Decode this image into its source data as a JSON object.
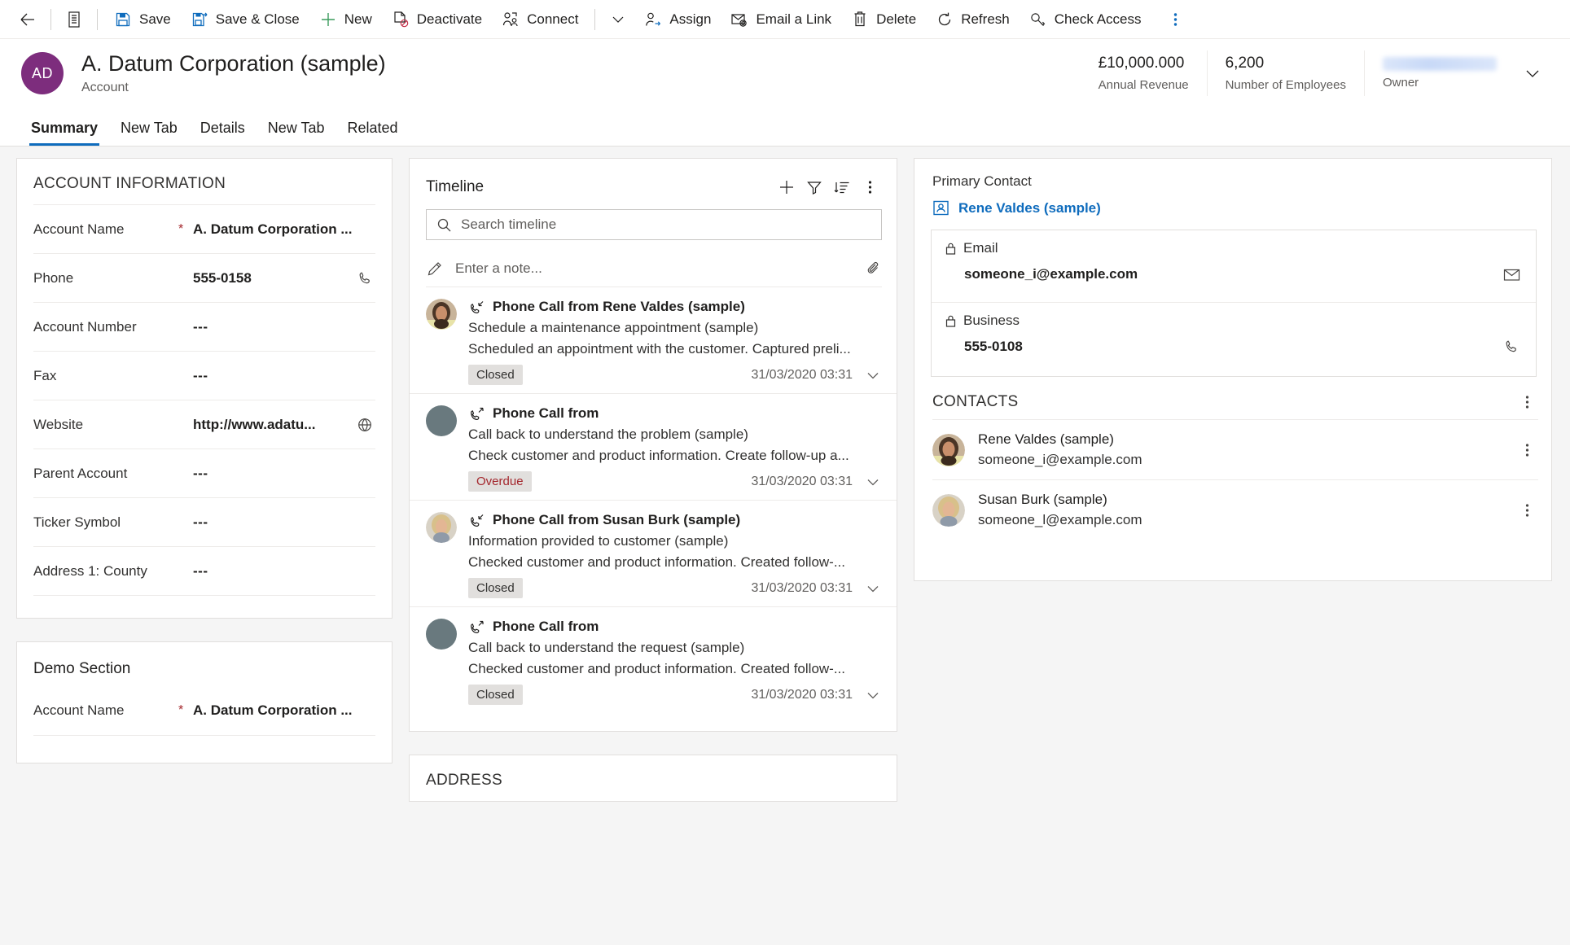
{
  "commandbar": {
    "back_label": "Back",
    "form_selector_label": "Form selector",
    "buttons": [
      {
        "label": "Save",
        "icon": "save-icon"
      },
      {
        "label": "Save & Close",
        "icon": "save-and-close-icon"
      },
      {
        "label": "New",
        "icon": "plus-icon"
      },
      {
        "label": "Deactivate",
        "icon": "deactivate-icon"
      },
      {
        "label": "Connect",
        "icon": "connect-icon"
      }
    ],
    "buttons2": [
      {
        "label": "Assign",
        "icon": "assign-person-icon"
      },
      {
        "label": "Email a Link",
        "icon": "email-link-icon"
      },
      {
        "label": "Delete",
        "icon": "trash-icon"
      },
      {
        "label": "Refresh",
        "icon": "refresh-icon"
      },
      {
        "label": "Check Access",
        "icon": "key-icon"
      }
    ],
    "overflow_label": "More commands",
    "chevron_label": "More"
  },
  "header": {
    "avatar_initials": "AD",
    "avatar_color": "#7d2d7d",
    "title": "A. Datum Corporation (sample)",
    "subtitle": "Account",
    "fields": [
      {
        "value": "£10,000.000",
        "label": "Annual Revenue"
      },
      {
        "value": "6,200",
        "label": "Number of Employees"
      },
      {
        "value": "",
        "label": "Owner",
        "redacted": true
      }
    ]
  },
  "tabs": [
    {
      "label": "Summary",
      "active": true
    },
    {
      "label": "New Tab",
      "active": false
    },
    {
      "label": "Details",
      "active": false
    },
    {
      "label": "New Tab",
      "active": false
    },
    {
      "label": "Related",
      "active": false
    }
  ],
  "account_information": {
    "title": "ACCOUNT INFORMATION",
    "fields": [
      {
        "label": "Account Name",
        "required": true,
        "value": "A. Datum Corporation ...",
        "action": ""
      },
      {
        "label": "Phone",
        "required": false,
        "value": "555-0158",
        "action": "phone-icon"
      },
      {
        "label": "Account Number",
        "required": false,
        "value": "---",
        "action": ""
      },
      {
        "label": "Fax",
        "required": false,
        "value": "---",
        "action": ""
      },
      {
        "label": "Website",
        "required": false,
        "value": "http://www.adatu...",
        "action": "globe-icon"
      },
      {
        "label": "Parent Account",
        "required": false,
        "value": "---",
        "action": ""
      },
      {
        "label": "Ticker Symbol",
        "required": false,
        "value": "---",
        "action": ""
      },
      {
        "label": "Address 1: County",
        "required": false,
        "value": "---",
        "action": ""
      }
    ]
  },
  "demo_section": {
    "title": "Demo Section",
    "fields": [
      {
        "label": "Account Name",
        "required": true,
        "value": "A. Datum Corporation ...",
        "action": ""
      }
    ]
  },
  "timeline": {
    "title": "Timeline",
    "add_label": "Create a timeline record",
    "filter_label": "Filter timeline",
    "sort_label": "Sort timeline",
    "more_label": "More timeline commands",
    "search_placeholder": "Search timeline",
    "search_value": "",
    "note_placeholder": "Enter a note...",
    "note_value": "",
    "attach_label": "Add attachment",
    "items": [
      {
        "subject": "Phone Call from Rene Valdes (sample)",
        "direction": "incoming",
        "avatar": "photo-female-1",
        "line1": "Schedule a maintenance appointment (sample)",
        "line2": "Scheduled an appointment with the customer. Captured preli...",
        "badge": "Closed",
        "badge_kind": "closed",
        "time": "31/03/2020 03:31"
      },
      {
        "subject": "Phone Call from",
        "direction": "outgoing",
        "avatar": "placeholder",
        "line1": "Call back to understand the problem (sample)",
        "line2": "Check customer and product information. Create follow-up a...",
        "badge": "Overdue",
        "badge_kind": "overdue",
        "time": "31/03/2020 03:31"
      },
      {
        "subject": "Phone Call from Susan Burk (sample)",
        "direction": "incoming",
        "avatar": "photo-female-2",
        "line1": "Information provided to customer (sample)",
        "line2": "Checked customer and product information. Created follow-...",
        "badge": "Closed",
        "badge_kind": "closed",
        "time": "31/03/2020 03:31"
      },
      {
        "subject": "Phone Call from",
        "direction": "outgoing",
        "avatar": "placeholder",
        "line1": "Call back to understand the request (sample)",
        "line2": "Checked customer and product information. Created follow-...",
        "badge": "Closed",
        "badge_kind": "closed",
        "time": "31/03/2020 03:31"
      }
    ]
  },
  "address_section": {
    "title": "ADDRESS"
  },
  "right": {
    "primary_contact_label": "Primary Contact",
    "primary_contact_name": "Rene Valdes (sample)",
    "fields": [
      {
        "label": "Email",
        "locked": true,
        "value": "someone_i@example.com",
        "action": "mail-icon"
      },
      {
        "label": "Business",
        "locked": true,
        "value": "555-0108",
        "action": "phone-icon"
      }
    ],
    "contacts_title": "CONTACTS",
    "contacts_more_label": "More contacts commands",
    "contacts": [
      {
        "name": "Rene Valdes (sample)",
        "email": "someone_i@example.com",
        "avatar": "photo-female-1"
      },
      {
        "name": "Susan Burk (sample)",
        "email": "someone_l@example.com",
        "avatar": "photo-female-2"
      }
    ]
  },
  "colors": {
    "accent": "#0f6cbd",
    "avatar_purple": "#7d2d7d",
    "overdue_red": "#a4262c",
    "required_red": "#a4262c",
    "badge_bg": "#e1dfdd",
    "page_bg": "#f5f5f5"
  }
}
